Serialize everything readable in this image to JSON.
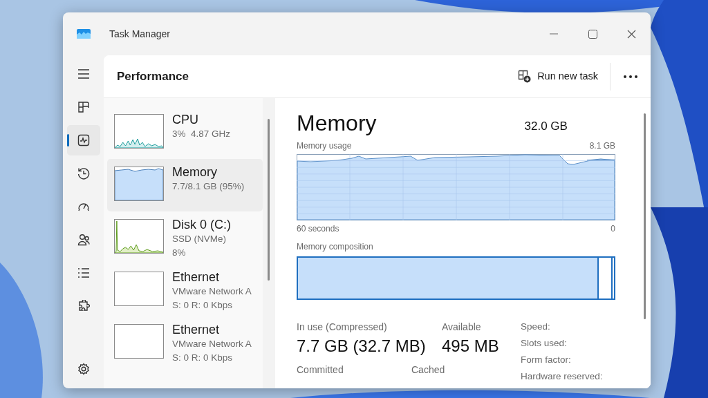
{
  "window": {
    "title": "Task Manager"
  },
  "nav": {
    "items": [
      {
        "kind": "menu",
        "selected": false
      },
      {
        "kind": "processes",
        "selected": false
      },
      {
        "kind": "performance",
        "selected": true
      },
      {
        "kind": "history",
        "selected": false
      },
      {
        "kind": "startup",
        "selected": false
      },
      {
        "kind": "users",
        "selected": false
      },
      {
        "kind": "details",
        "selected": false
      },
      {
        "kind": "services",
        "selected": false
      },
      {
        "kind": "settings",
        "selected": false
      }
    ]
  },
  "header": {
    "title": "Performance",
    "action": "Run new task"
  },
  "devices": [
    {
      "name": "CPU",
      "details": [
        "3%  4.87 GHz"
      ],
      "kind": "cpu",
      "selected": false
    },
    {
      "name": "Memory",
      "details": [
        "7.7/8.1 GB (95%)"
      ],
      "kind": "memory",
      "selected": true
    },
    {
      "name": "Disk 0 (C:)",
      "details": [
        "SSD (NVMe)",
        "8%"
      ],
      "kind": "disk",
      "selected": false
    },
    {
      "name": "Ethernet",
      "details": [
        "VMware Network A",
        "S: 0 R: 0 Kbps"
      ],
      "kind": "network",
      "selected": false
    },
    {
      "name": "Ethernet",
      "details": [
        "VMware Network A",
        "S: 0 R: 0 Kbps"
      ],
      "kind": "network",
      "selected": false
    }
  ],
  "detail": {
    "title": "Memory",
    "total": "32.0 GB",
    "usage_label": "Memory usage",
    "usage_max": "8.1 GB",
    "time_start": "60 seconds",
    "time_end": "0",
    "composition_label": "Memory composition",
    "stat_rows": [
      [
        {
          "label": "In use (Compressed)",
          "value": "7.7 GB (32.7 MB)"
        },
        {
          "label": "Available",
          "value": "495 MB"
        }
      ],
      [
        {
          "label": "Committed"
        },
        {
          "label": "Cached"
        }
      ]
    ],
    "properties": [
      "Speed:",
      "Slots used:",
      "Form factor:",
      "Hardware reserved:"
    ]
  }
}
